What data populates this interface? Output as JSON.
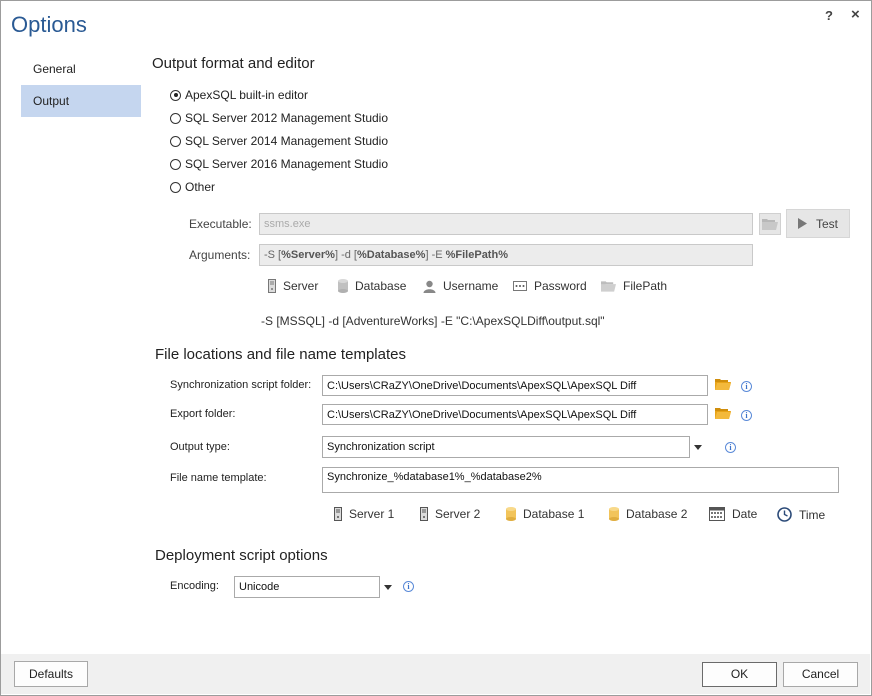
{
  "window": {
    "title": "Options",
    "help_label": "?",
    "close_label": "×"
  },
  "nav": {
    "items": [
      {
        "label": "General"
      },
      {
        "label": "Output"
      }
    ]
  },
  "output_format": {
    "section_title": "Output format and editor",
    "options": [
      {
        "label": "ApexSQL built-in editor",
        "checked": true
      },
      {
        "label": "SQL Server 2012 Management Studio",
        "checked": false
      },
      {
        "label": "SQL Server 2014 Management Studio",
        "checked": false
      },
      {
        "label": "SQL Server 2016 Management Studio",
        "checked": false
      },
      {
        "label": "Other",
        "checked": false
      }
    ],
    "executable_label": "Executable:",
    "executable_placeholder": "ssms.exe",
    "test_label": "Test",
    "arguments_label": "Arguments:",
    "arguments_parts": [
      "-S [",
      "%Server%",
      "] -d [",
      "%Database%",
      "] -E ",
      "%FilePath%"
    ],
    "tokens": [
      "Server",
      "Database",
      "Username",
      "Password",
      "FilePath"
    ],
    "preview": "-S [MSSQL] -d [AdventureWorks] -E \"C:\\ApexSQLDiff\\output.sql\""
  },
  "file_locations": {
    "section_title": "File locations and file name templates",
    "sync_folder_label": "Synchronization script folder:",
    "sync_folder_value": "C:\\Users\\CRaZY\\OneDrive\\Documents\\ApexSQL\\ApexSQL Diff",
    "export_folder_label": "Export folder:",
    "export_folder_value": "C:\\Users\\CRaZY\\OneDrive\\Documents\\ApexSQL\\ApexSQL Diff",
    "output_type_label": "Output type:",
    "output_type_value": "Synchronization script",
    "template_label": "File name template:",
    "template_value": "Synchronize_%database1%_%database2%",
    "tokens": [
      "Server 1",
      "Server 2",
      "Database 1",
      "Database 2",
      "Date",
      "Time"
    ]
  },
  "deployment": {
    "section_title": "Deployment script options",
    "encoding_label": "Encoding:",
    "encoding_value": "Unicode"
  },
  "footer": {
    "defaults_label": "Defaults",
    "ok_label": "OK",
    "cancel_label": "Cancel"
  },
  "colors": {
    "accent": "#2a5a94",
    "nav_active": "#c5d6ef",
    "folder": "#e8a317",
    "db": "#f2c45a",
    "info": "#3d72c9"
  }
}
